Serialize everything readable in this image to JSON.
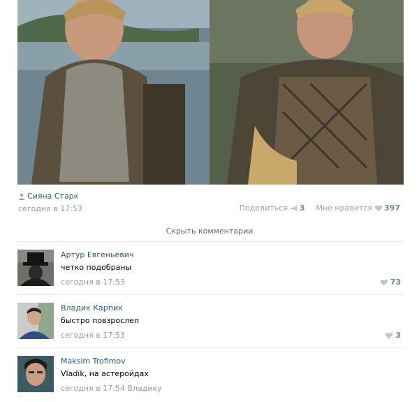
{
  "post": {
    "author": "Сияна Старк",
    "time": "сегодня в 17:53",
    "share_label": "Поделиться",
    "share_count": "3",
    "like_label": "Мне нравится",
    "like_count": "397"
  },
  "comments_toggle": "Скрыть комментарии",
  "comments": [
    {
      "author": "Артур Евгеньевич",
      "text": "четко подобраны",
      "time": "сегодня в 17:53",
      "likes": "73"
    },
    {
      "author": "Владик Карпик",
      "text": "быстро повзрослел",
      "time": "сегодня в 17:53",
      "likes": "3"
    },
    {
      "author": "Maksim Trofimov",
      "text": "Vladik, на астеройдах",
      "time": "сегодня в 17:54 Владику",
      "likes": ""
    }
  ],
  "colors": {
    "link": "#2b587a",
    "muted": "#999999",
    "accent": "#6d88a3"
  },
  "icons": [
    "person-icon",
    "megaphone-icon",
    "heart-icon"
  ]
}
